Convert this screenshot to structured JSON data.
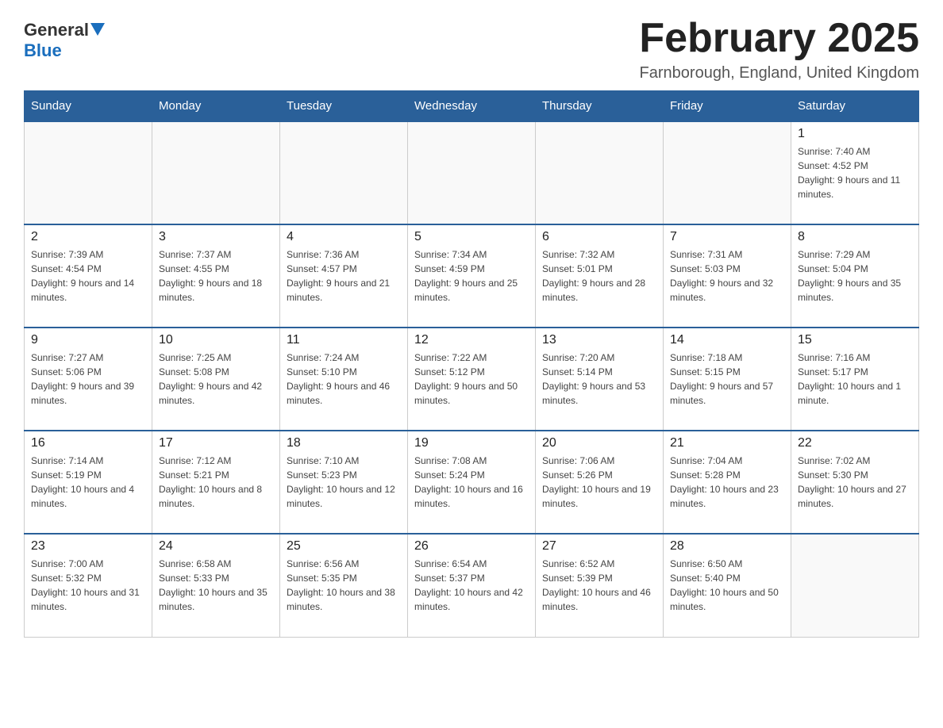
{
  "logo": {
    "general": "General",
    "blue": "Blue"
  },
  "title": "February 2025",
  "location": "Farnborough, England, United Kingdom",
  "weekdays": [
    "Sunday",
    "Monday",
    "Tuesday",
    "Wednesday",
    "Thursday",
    "Friday",
    "Saturday"
  ],
  "weeks": [
    [
      {
        "day": "",
        "info": ""
      },
      {
        "day": "",
        "info": ""
      },
      {
        "day": "",
        "info": ""
      },
      {
        "day": "",
        "info": ""
      },
      {
        "day": "",
        "info": ""
      },
      {
        "day": "",
        "info": ""
      },
      {
        "day": "1",
        "info": "Sunrise: 7:40 AM\nSunset: 4:52 PM\nDaylight: 9 hours and 11 minutes."
      }
    ],
    [
      {
        "day": "2",
        "info": "Sunrise: 7:39 AM\nSunset: 4:54 PM\nDaylight: 9 hours and 14 minutes."
      },
      {
        "day": "3",
        "info": "Sunrise: 7:37 AM\nSunset: 4:55 PM\nDaylight: 9 hours and 18 minutes."
      },
      {
        "day": "4",
        "info": "Sunrise: 7:36 AM\nSunset: 4:57 PM\nDaylight: 9 hours and 21 minutes."
      },
      {
        "day": "5",
        "info": "Sunrise: 7:34 AM\nSunset: 4:59 PM\nDaylight: 9 hours and 25 minutes."
      },
      {
        "day": "6",
        "info": "Sunrise: 7:32 AM\nSunset: 5:01 PM\nDaylight: 9 hours and 28 minutes."
      },
      {
        "day": "7",
        "info": "Sunrise: 7:31 AM\nSunset: 5:03 PM\nDaylight: 9 hours and 32 minutes."
      },
      {
        "day": "8",
        "info": "Sunrise: 7:29 AM\nSunset: 5:04 PM\nDaylight: 9 hours and 35 minutes."
      }
    ],
    [
      {
        "day": "9",
        "info": "Sunrise: 7:27 AM\nSunset: 5:06 PM\nDaylight: 9 hours and 39 minutes."
      },
      {
        "day": "10",
        "info": "Sunrise: 7:25 AM\nSunset: 5:08 PM\nDaylight: 9 hours and 42 minutes."
      },
      {
        "day": "11",
        "info": "Sunrise: 7:24 AM\nSunset: 5:10 PM\nDaylight: 9 hours and 46 minutes."
      },
      {
        "day": "12",
        "info": "Sunrise: 7:22 AM\nSunset: 5:12 PM\nDaylight: 9 hours and 50 minutes."
      },
      {
        "day": "13",
        "info": "Sunrise: 7:20 AM\nSunset: 5:14 PM\nDaylight: 9 hours and 53 minutes."
      },
      {
        "day": "14",
        "info": "Sunrise: 7:18 AM\nSunset: 5:15 PM\nDaylight: 9 hours and 57 minutes."
      },
      {
        "day": "15",
        "info": "Sunrise: 7:16 AM\nSunset: 5:17 PM\nDaylight: 10 hours and 1 minute."
      }
    ],
    [
      {
        "day": "16",
        "info": "Sunrise: 7:14 AM\nSunset: 5:19 PM\nDaylight: 10 hours and 4 minutes."
      },
      {
        "day": "17",
        "info": "Sunrise: 7:12 AM\nSunset: 5:21 PM\nDaylight: 10 hours and 8 minutes."
      },
      {
        "day": "18",
        "info": "Sunrise: 7:10 AM\nSunset: 5:23 PM\nDaylight: 10 hours and 12 minutes."
      },
      {
        "day": "19",
        "info": "Sunrise: 7:08 AM\nSunset: 5:24 PM\nDaylight: 10 hours and 16 minutes."
      },
      {
        "day": "20",
        "info": "Sunrise: 7:06 AM\nSunset: 5:26 PM\nDaylight: 10 hours and 19 minutes."
      },
      {
        "day": "21",
        "info": "Sunrise: 7:04 AM\nSunset: 5:28 PM\nDaylight: 10 hours and 23 minutes."
      },
      {
        "day": "22",
        "info": "Sunrise: 7:02 AM\nSunset: 5:30 PM\nDaylight: 10 hours and 27 minutes."
      }
    ],
    [
      {
        "day": "23",
        "info": "Sunrise: 7:00 AM\nSunset: 5:32 PM\nDaylight: 10 hours and 31 minutes."
      },
      {
        "day": "24",
        "info": "Sunrise: 6:58 AM\nSunset: 5:33 PM\nDaylight: 10 hours and 35 minutes."
      },
      {
        "day": "25",
        "info": "Sunrise: 6:56 AM\nSunset: 5:35 PM\nDaylight: 10 hours and 38 minutes."
      },
      {
        "day": "26",
        "info": "Sunrise: 6:54 AM\nSunset: 5:37 PM\nDaylight: 10 hours and 42 minutes."
      },
      {
        "day": "27",
        "info": "Sunrise: 6:52 AM\nSunset: 5:39 PM\nDaylight: 10 hours and 46 minutes."
      },
      {
        "day": "28",
        "info": "Sunrise: 6:50 AM\nSunset: 5:40 PM\nDaylight: 10 hours and 50 minutes."
      },
      {
        "day": "",
        "info": ""
      }
    ]
  ]
}
